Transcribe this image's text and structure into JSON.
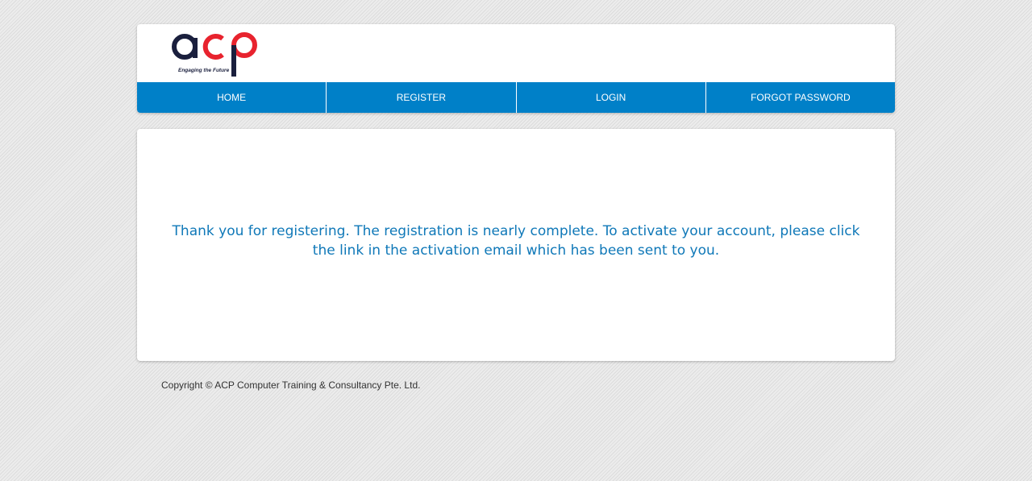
{
  "logo": {
    "name": "acp",
    "tagline": "Engaging the Future"
  },
  "nav": {
    "items": [
      {
        "label": "HOME"
      },
      {
        "label": "REGISTER"
      },
      {
        "label": "LOGIN"
      },
      {
        "label": "FORGOT PASSWORD"
      }
    ]
  },
  "main": {
    "message": "Thank you for registering. The registration is nearly complete. To activate your account, please click the link in the activation email which has been sent to you."
  },
  "footer": {
    "copyright": "Copyright © ACP Computer Training & Consultancy Pte. Ltd."
  },
  "colors": {
    "nav_background": "#0080c8",
    "message_text": "#0f78b8",
    "logo_navy": "#1a1f3d",
    "logo_red": "#e8232e"
  }
}
